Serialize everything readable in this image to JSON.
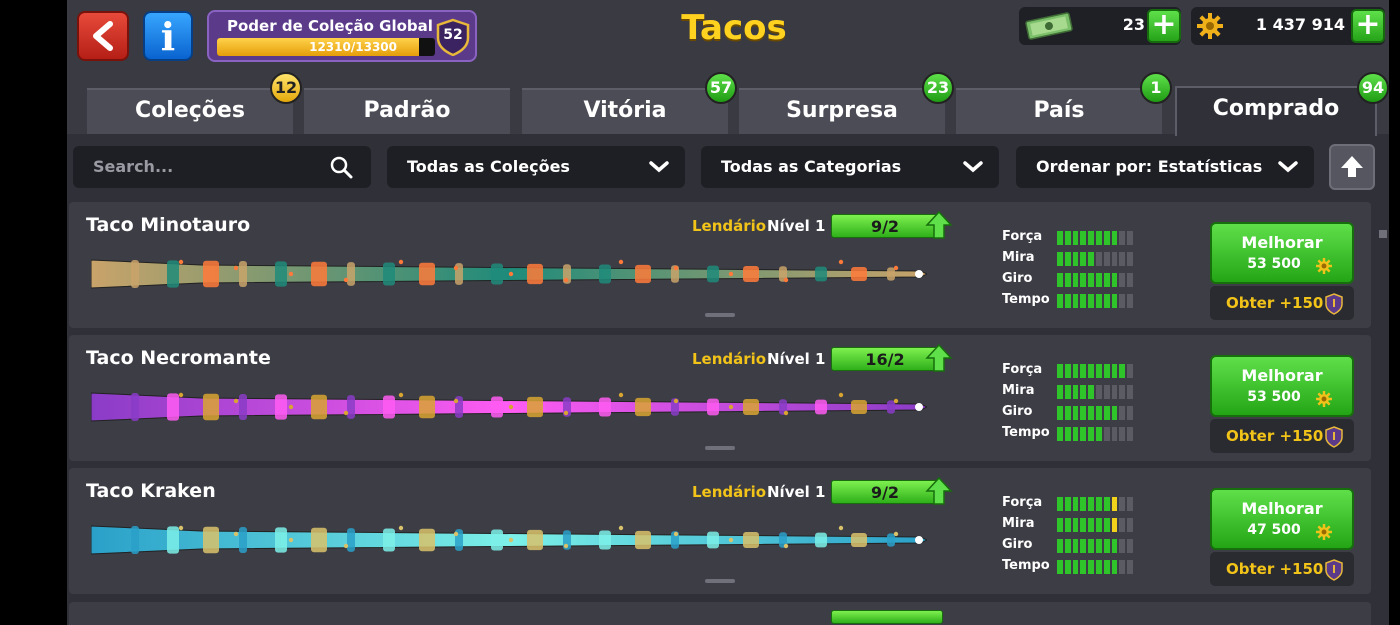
{
  "header": {
    "title": "Tacos",
    "collection_power": {
      "label": "Poder de Coleção Global",
      "progress_text": "12310/13300",
      "progress_fraction": 0.9256,
      "level": "52"
    },
    "cash": "23",
    "coins": "1 437 914"
  },
  "tabs": [
    {
      "label": "Coleções",
      "badge": "12",
      "badge_color": "yellow"
    },
    {
      "label": "Padrão",
      "badge": ""
    },
    {
      "label": "Vitória",
      "badge": "57",
      "badge_color": "green"
    },
    {
      "label": "Surpresa",
      "badge": "23",
      "badge_color": "green"
    },
    {
      "label": "País",
      "badge": "1",
      "badge_color": "green"
    },
    {
      "label": "Comprado",
      "badge": "94",
      "badge_color": "green",
      "active": true
    }
  ],
  "filters": {
    "search_placeholder": "Search...",
    "collections": "Todas as Coleções",
    "categories": "Todas as Categorias",
    "sort": "Ordenar por: Estatísticas"
  },
  "stat_labels": {
    "force": "Força",
    "aim": "Mira",
    "spin": "Giro",
    "time": "Tempo"
  },
  "cues": [
    {
      "name": "Taco Minotauro",
      "rarity": "Lendário",
      "level": "Nível 1",
      "pieces": "9/2",
      "stats": {
        "force": 8,
        "aim": 5,
        "spin": 8,
        "time": 8
      },
      "upgrade_label": "Melhorar",
      "upgrade_cost": "53 500",
      "obtain": "Obter +150",
      "palette": [
        "#c9a36a",
        "#1e8b7a",
        "#ff7a3a"
      ]
    },
    {
      "name": "Taco Necromante",
      "rarity": "Lendário",
      "level": "Nível 1",
      "pieces": "16/2",
      "stats": {
        "force": 9,
        "aim": 5,
        "spin": 8,
        "time": 6
      },
      "upgrade_label": "Melhorar",
      "upgrade_cost": "53 500",
      "obtain": "Obter +150",
      "palette": [
        "#8a3cc7",
        "#ff5cf2",
        "#d9a531"
      ]
    },
    {
      "name": "Taco Kraken",
      "rarity": "Lendário",
      "level": "Nível 1",
      "pieces": "9/2",
      "stats": {
        "force": 7,
        "aim": 7,
        "spin": 8,
        "time": 8
      },
      "upgrade_label": "Melhorar",
      "upgrade_cost": "47 500",
      "obtain": "Obter +150",
      "palette": [
        "#2aa0c9",
        "#7cf0e8",
        "#d9c26a"
      ]
    }
  ]
}
